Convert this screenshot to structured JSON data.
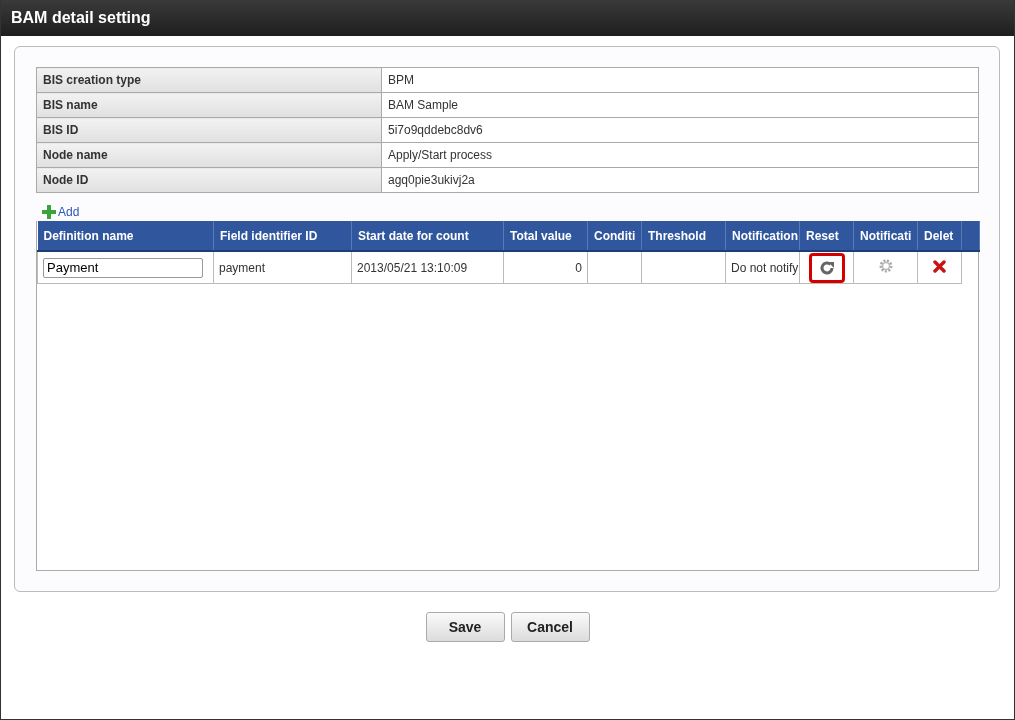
{
  "window": {
    "title": "BAM detail setting"
  },
  "info": [
    {
      "label": "BIS creation type",
      "value": "BPM"
    },
    {
      "label": "BIS name",
      "value": "BAM Sample"
    },
    {
      "label": "BIS ID",
      "value": "5i7o9qddebc8dv6"
    },
    {
      "label": "Node name",
      "value": "Apply/Start process"
    },
    {
      "label": "Node ID",
      "value": "agq0pie3ukivj2a"
    }
  ],
  "add_link": "Add",
  "table": {
    "columns": [
      "Definition name",
      "Field identifier ID",
      "Start date for count",
      "Total value",
      "Conditi",
      "Threshold",
      "Notification",
      "Reset",
      "Notificati",
      "Delet"
    ],
    "rows": [
      {
        "definition_name": "Payment",
        "field_identifier_id": "payment",
        "start_date": "2013/05/21 13:10:09",
        "total_value": "0",
        "notification": "Do not notify",
        "reset_highlighted": true
      }
    ]
  },
  "buttons": [
    "Save",
    "Cancel"
  ]
}
